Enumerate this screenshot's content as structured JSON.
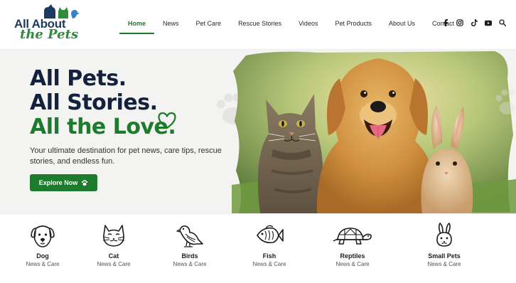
{
  "brand": {
    "line1": "All About",
    "line2": "the Pets"
  },
  "nav": {
    "items": [
      {
        "label": "Home",
        "active": true
      },
      {
        "label": "News"
      },
      {
        "label": "Pet Care"
      },
      {
        "label": "Rescue Stories"
      },
      {
        "label": "Videos"
      },
      {
        "label": "Pet Products"
      },
      {
        "label": "About Us"
      },
      {
        "label": "Contact"
      }
    ]
  },
  "social": [
    "facebook-icon",
    "instagram-icon",
    "tiktok-icon",
    "youtube-icon",
    "search-icon"
  ],
  "hero": {
    "title_line1": "All Pets.",
    "title_line2": "All Stories.",
    "title_line3": "All the Love.",
    "subtitle": "Your ultimate destination for pet news, care tips, rescue stories, and endless fun.",
    "button_label": "Explore Now"
  },
  "categories": [
    {
      "name": "Dog",
      "sub": "News & Care",
      "icon": "dog-icon"
    },
    {
      "name": "Cat",
      "sub": "News & Care",
      "icon": "cat-icon"
    },
    {
      "name": "Birds",
      "sub": "News & Care",
      "icon": "bird-icon"
    },
    {
      "name": "Fish",
      "sub": "News & Care",
      "icon": "fish-icon"
    },
    {
      "name": "Reptiles",
      "sub": "News & Care",
      "icon": "turtle-icon"
    },
    {
      "name": "Small Pets",
      "sub": "News & Care",
      "icon": "rabbit-icon"
    }
  ],
  "colors": {
    "brand_green": "#1e7a2c",
    "navy": "#14213d",
    "hero_bg": "#f3f3f1"
  }
}
